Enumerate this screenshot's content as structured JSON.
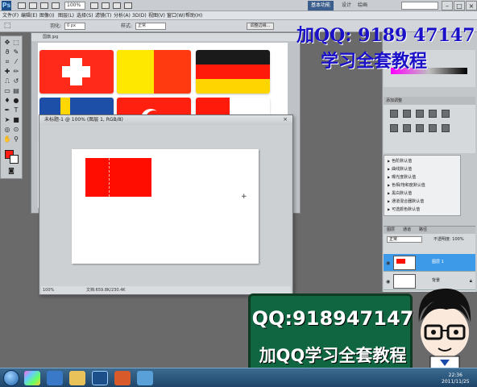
{
  "app": {
    "logo": "Ps",
    "zoom": "100%",
    "workspaces": [
      "基本功能",
      "设计",
      "绘画"
    ],
    "window_buttons": [
      "–",
      "□",
      "×"
    ]
  },
  "menu": [
    "文件(F)",
    "编辑(E)",
    "图像(I)",
    "图层(L)",
    "选择(S)",
    "滤镜(T)",
    "分析(A)",
    "3D(D)",
    "视图(V)",
    "窗口(W)",
    "帮助(H)"
  ],
  "options": {
    "feather_label": "羽化:",
    "feather_value": "0 px",
    "style_label": "样式:",
    "style_value": "正常",
    "refine_button": "调整边缘..."
  },
  "tools": {
    "foreground_color": "#ff1a12",
    "background_color": "#ffffff"
  },
  "back_document": {
    "title": "国旗.jpg"
  },
  "front_document": {
    "title": "未标题-1 @ 100% (图层 1, RGB/8)",
    "close": "×",
    "zoom": "100%",
    "status": "文档:659.8K/230.4K",
    "shape_color": "#ff0d00"
  },
  "panels": {
    "adjustments_title": "添加调整",
    "presets": [
      "色阶默认值",
      "曲线默认值",
      "曝光度默认值",
      "色相/饱和度默认值",
      "黑白默认值",
      "通道混合器默认值",
      "可选颜色默认值"
    ]
  },
  "layers": {
    "tabs": [
      "图层",
      "通道",
      "路径"
    ],
    "blend_mode": "正常",
    "opacity_label": "不透明度: 100%",
    "rows": [
      {
        "name": "图层 1",
        "selected": true
      },
      {
        "name": "背景",
        "selected": false
      }
    ]
  },
  "watermark": {
    "line1": "加QQ: 9189 47147",
    "line2": "学习全套教程"
  },
  "banner": {
    "qq": "QQ:918947147",
    "subtitle": "加QQ学习全套教程"
  },
  "taskbar": {
    "clock_time": "22:36",
    "clock_date": "2011/11/25"
  }
}
